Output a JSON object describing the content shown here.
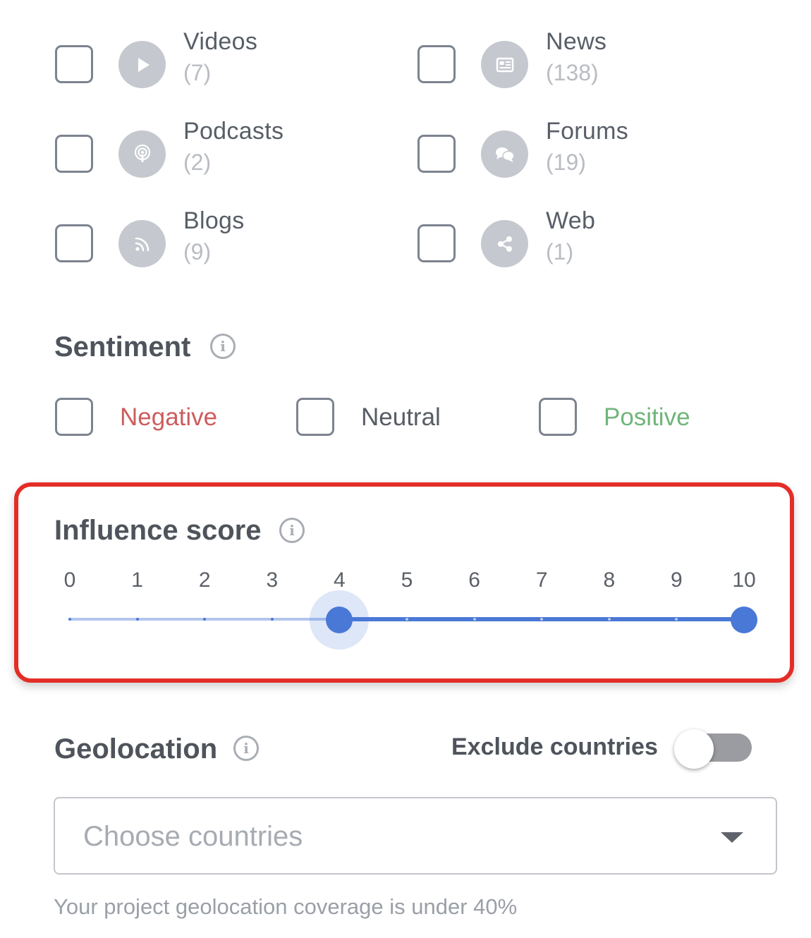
{
  "sources": [
    {
      "label": "Videos",
      "count": "(7)",
      "icon": "play-icon"
    },
    {
      "label": "News",
      "count": "(138)",
      "icon": "newspaper-icon"
    },
    {
      "label": "Podcasts",
      "count": "(2)",
      "icon": "podcast-icon"
    },
    {
      "label": "Forums",
      "count": "(19)",
      "icon": "chat-bubbles-icon"
    },
    {
      "label": "Blogs",
      "count": "(9)",
      "icon": "rss-icon"
    },
    {
      "label": "Web",
      "count": "(1)",
      "icon": "share-icon"
    }
  ],
  "sentiment": {
    "title": "Sentiment",
    "info_glyph": "i",
    "options": [
      {
        "label": "Negative",
        "color": "#cd5d5e"
      },
      {
        "label": "Neutral",
        "color": "#575c64"
      },
      {
        "label": "Positive",
        "color": "#70b57a"
      }
    ]
  },
  "influence": {
    "title": "Influence score",
    "info_glyph": "i",
    "ticks": [
      "0",
      "1",
      "2",
      "3",
      "4",
      "5",
      "6",
      "7",
      "8",
      "9",
      "10"
    ],
    "min": 0,
    "max": 10,
    "range_low": 4,
    "range_high": 10,
    "highlight_color": "#e42d27",
    "accent_color": "#4a78d6"
  },
  "geolocation": {
    "title": "Geolocation",
    "info_glyph": "i",
    "exclude_label": "Exclude countries",
    "exclude_enabled": false,
    "select_placeholder": "Choose countries",
    "helper_text": "Your project geolocation coverage is under 40%"
  }
}
